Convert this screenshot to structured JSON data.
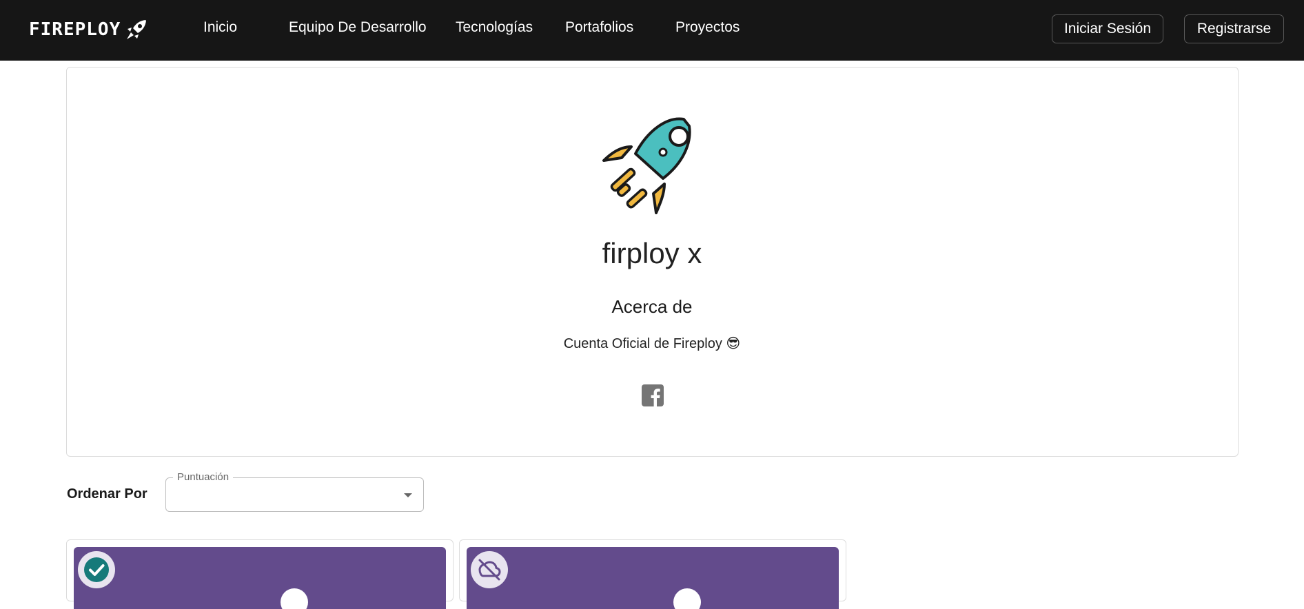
{
  "nav": {
    "brand": "FIREPLOY",
    "links": [
      "Inicio",
      "Equipo De Desarrollo",
      "Tecnologías",
      "Portafolios",
      "Proyectos"
    ],
    "login_label": "Iniciar Sesión",
    "register_label": "Registrarse"
  },
  "profile": {
    "name": "firploy x",
    "about_title": "Acerca de",
    "about_text": "Cuenta Oficial de Fireploy 😎"
  },
  "sort": {
    "label": "Ordenar Por",
    "field_label": "Puntuación",
    "value": ""
  },
  "projects": [
    {
      "status_icon": "check-circle-icon",
      "banner_color": "#634b8c"
    },
    {
      "status_icon": "cloud-off-icon",
      "banner_color": "#634b8c"
    }
  ],
  "colors": {
    "topbar": "#161616",
    "rocket_body": "#4bbfbf",
    "rocket_fins": "#f1b83f",
    "facebook": "#757575",
    "check_badge": "#167a7a"
  }
}
